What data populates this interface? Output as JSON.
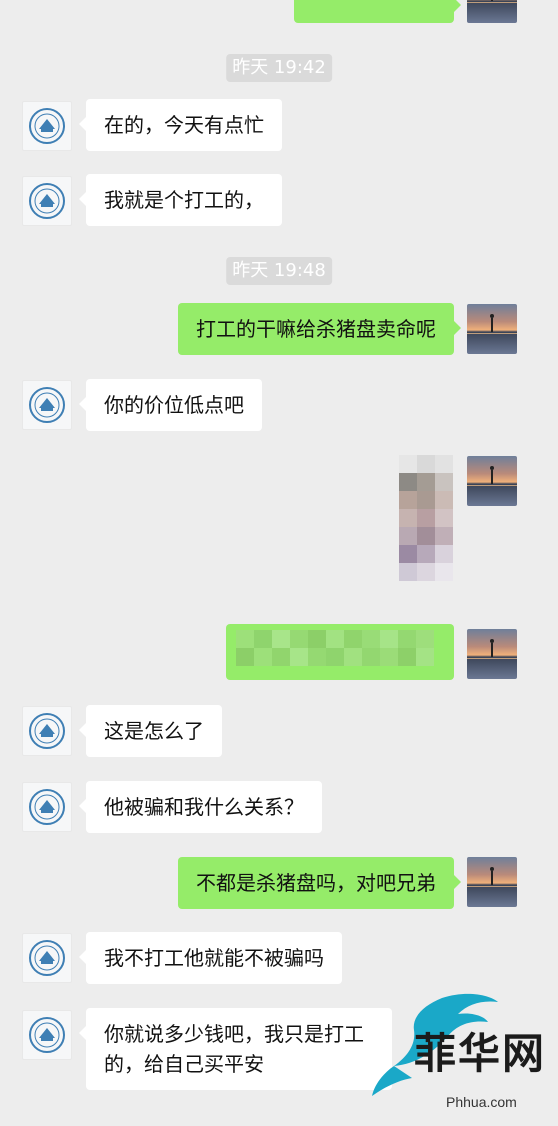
{
  "chat": {
    "timestamps": [
      "昨天 19:42",
      "昨天 19:48"
    ],
    "messages": [
      {
        "text": "在的，今天有点忙"
      },
      {
        "text": "我就是个打工的，"
      },
      {
        "text": "打工的干嘛给杀猪盘卖命呢"
      },
      {
        "text": "你的价位低点吧"
      },
      {
        "text": "这是怎么了"
      },
      {
        "text": "他被骗和我什么关系？"
      },
      {
        "text": "不都是杀猪盘吗，对吧兄弟"
      },
      {
        "text": "我不打工他就能不被骗吗"
      },
      {
        "text": "你就说多少钱吧，我只是打工的，给自己买平安"
      }
    ]
  },
  "watermark": {
    "brand": "菲华网",
    "url": "Phhua.com"
  },
  "colors": {
    "background": "#ededed",
    "sent_bubble": "#95ec69",
    "received_bubble": "#ffffff",
    "timestamp_bg": "#dadada"
  }
}
